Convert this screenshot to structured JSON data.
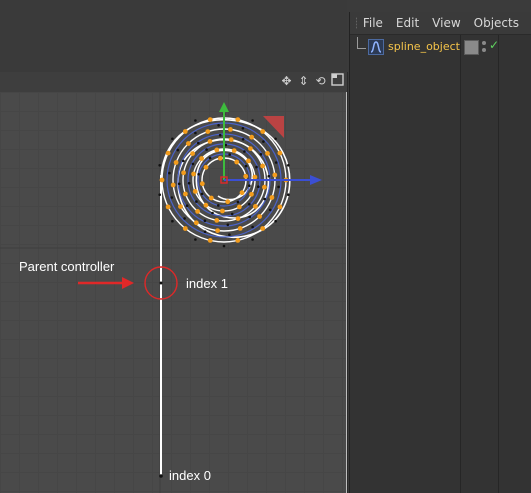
{
  "object_manager": {
    "menu": [
      "File",
      "Edit",
      "View",
      "Objects"
    ],
    "object_name": "spline_object"
  },
  "viewport": {
    "toolbar_icons": [
      "move-view-icon",
      "pan-vertical-icon",
      "rotate-view-icon",
      "toggle-view-icon"
    ],
    "annotations": {
      "parent_label": "Parent controller",
      "index1": "index 1",
      "index0": "index 0"
    }
  },
  "colors": {
    "spline": "#ffffff",
    "points": "#f39c1c",
    "axis_y": "#3dbb3d",
    "axis_x": "#3b4fd4",
    "arrow": "#e02828",
    "selected_name": "#f5c44a"
  }
}
